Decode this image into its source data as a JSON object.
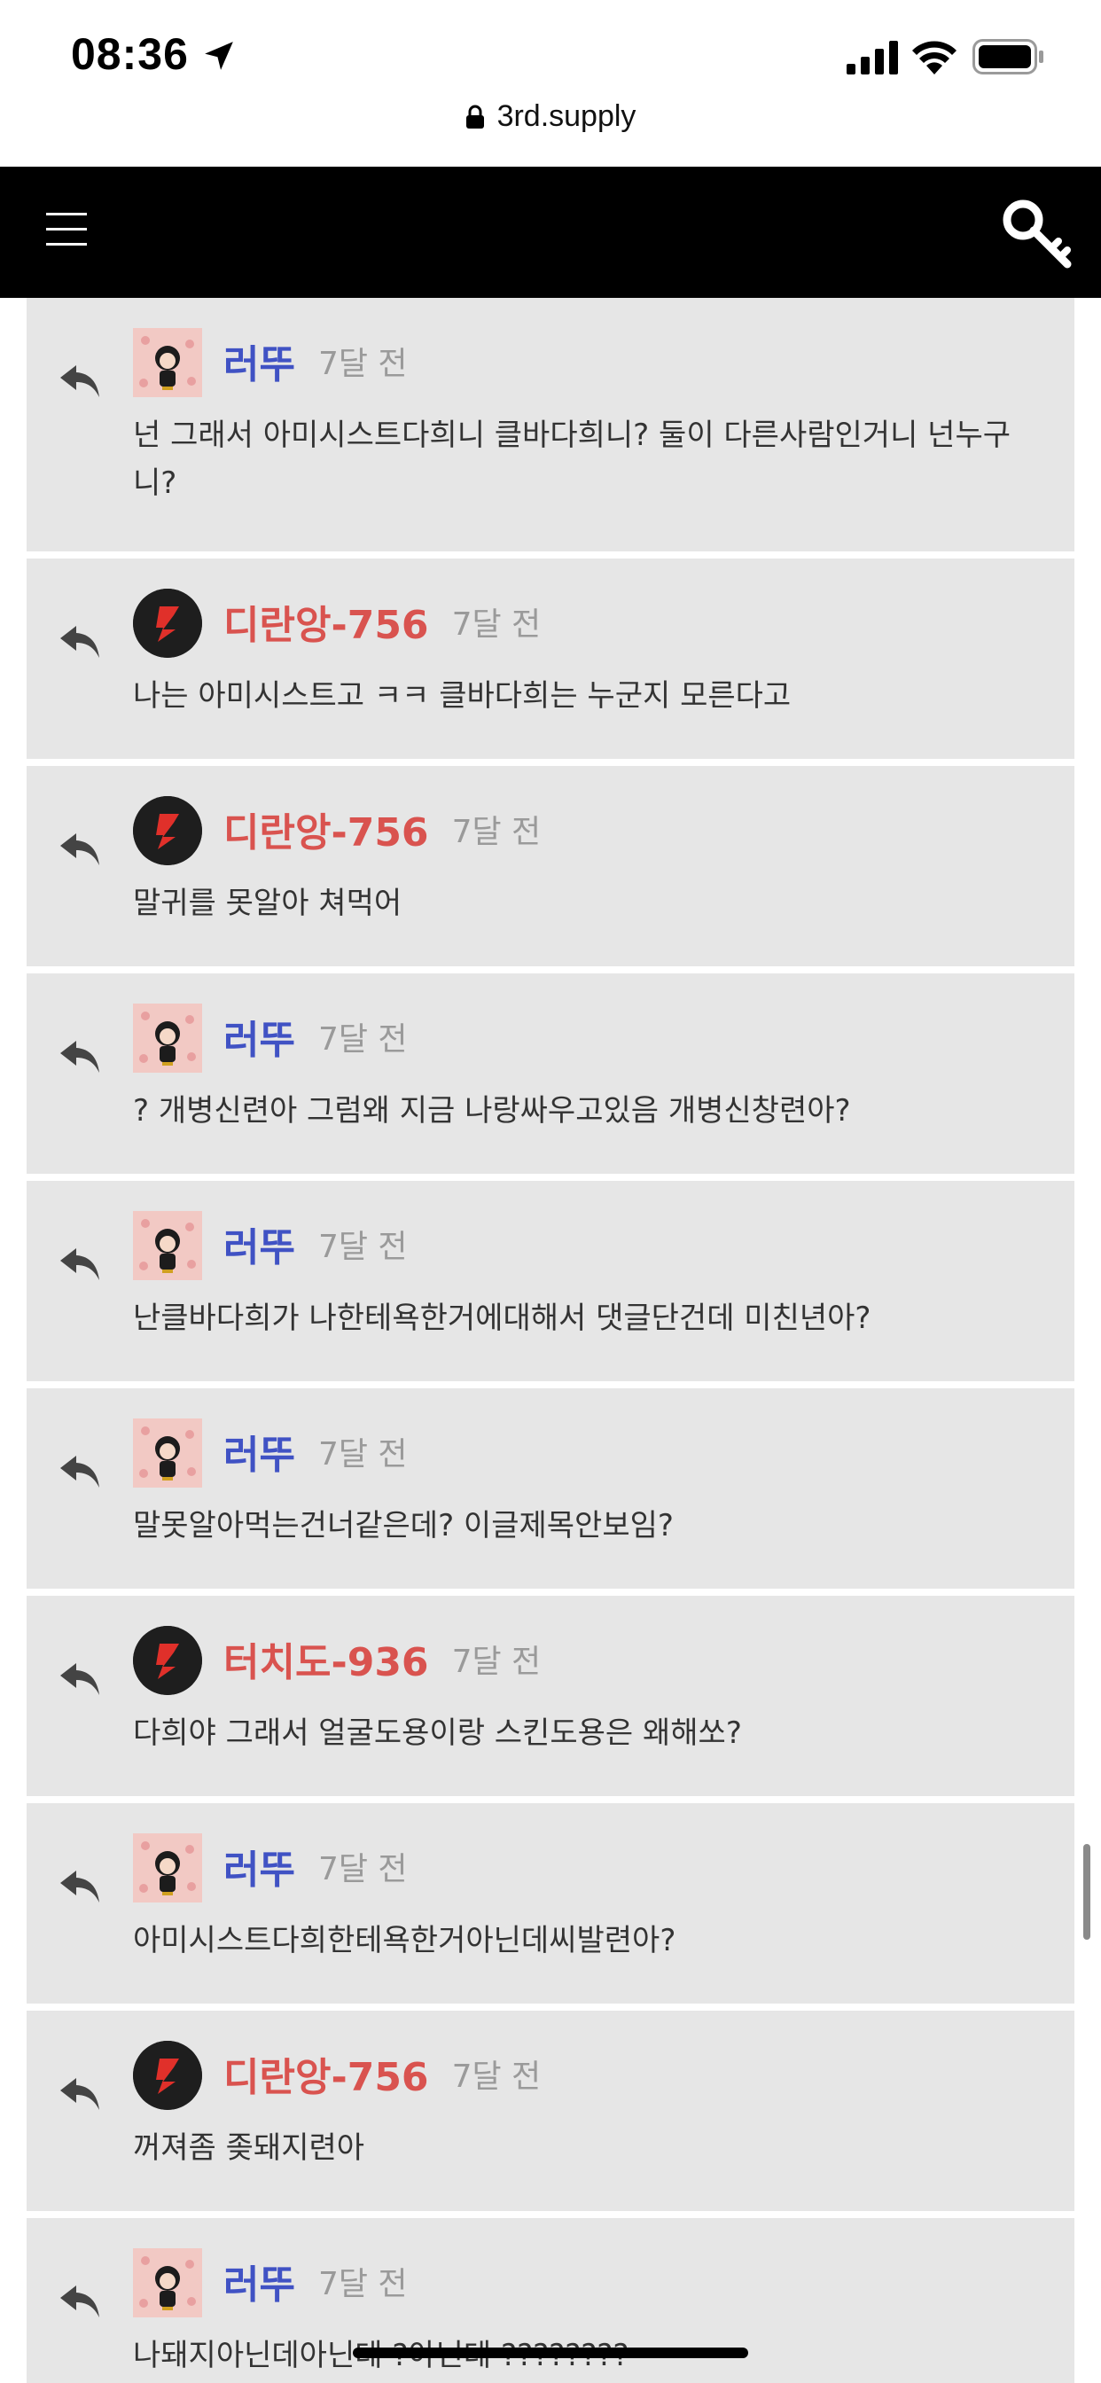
{
  "status_bar": {
    "time": "08:36",
    "icons": [
      "location-arrow-icon",
      "cellular-signal-icon",
      "wifi-icon",
      "battery-icon"
    ]
  },
  "browser": {
    "url": "3rd.supply",
    "icon": "lock-icon"
  },
  "header": {
    "menu_icon": "hamburger-menu-icon",
    "login_icon": "key-icon",
    "background": "#000000"
  },
  "colors": {
    "member_name": "#4052c4",
    "guest_name": "#d9534f",
    "comment_bg": "#e6e6e6",
    "timestamp": "#9a9a9a"
  },
  "comments": [
    {
      "author": "러뚜",
      "type": "member",
      "time": "7달 전",
      "text": "넌 그래서 아미시스트다희니 클바다희니? 둘이 다른사람인거니 넌누구니?"
    },
    {
      "author": "디란앙-756",
      "type": "guest",
      "time": "7달 전",
      "text": "나는 아미시스트고 ㅋㅋ 클바다희는 누군지 모른다고"
    },
    {
      "author": "디란앙-756",
      "type": "guest",
      "time": "7달 전",
      "text": "말귀를 못알아 쳐먹어"
    },
    {
      "author": "러뚜",
      "type": "member",
      "time": "7달 전",
      "text": "? 개병신련아 그럼왜 지금 나랑싸우고있음 개병신창련아?"
    },
    {
      "author": "러뚜",
      "type": "member",
      "time": "7달 전",
      "text": "난클바다희가 나한테욕한거에대해서 댓글단건데 미친년아?"
    },
    {
      "author": "러뚜",
      "type": "member",
      "time": "7달 전",
      "text": "말못알아먹는건너같은데? 이글제목안보임?"
    },
    {
      "author": "터치도-936",
      "type": "guest",
      "time": "7달 전",
      "text": "다희야 그래서 얼굴도용이랑 스킨도용은 왜해쏘?"
    },
    {
      "author": "러뚜",
      "type": "member",
      "time": "7달 전",
      "text": "아미시스트다희한테욕한거아닌데씨발련아?"
    },
    {
      "author": "디란앙-756",
      "type": "guest",
      "time": "7달 전",
      "text": "꺼져좀 좆돼지련아"
    },
    {
      "author": "러뚜",
      "type": "member",
      "time": "7달 전",
      "text": "나돼지아닌데아닌데 ?아닌데 ????????"
    }
  ]
}
